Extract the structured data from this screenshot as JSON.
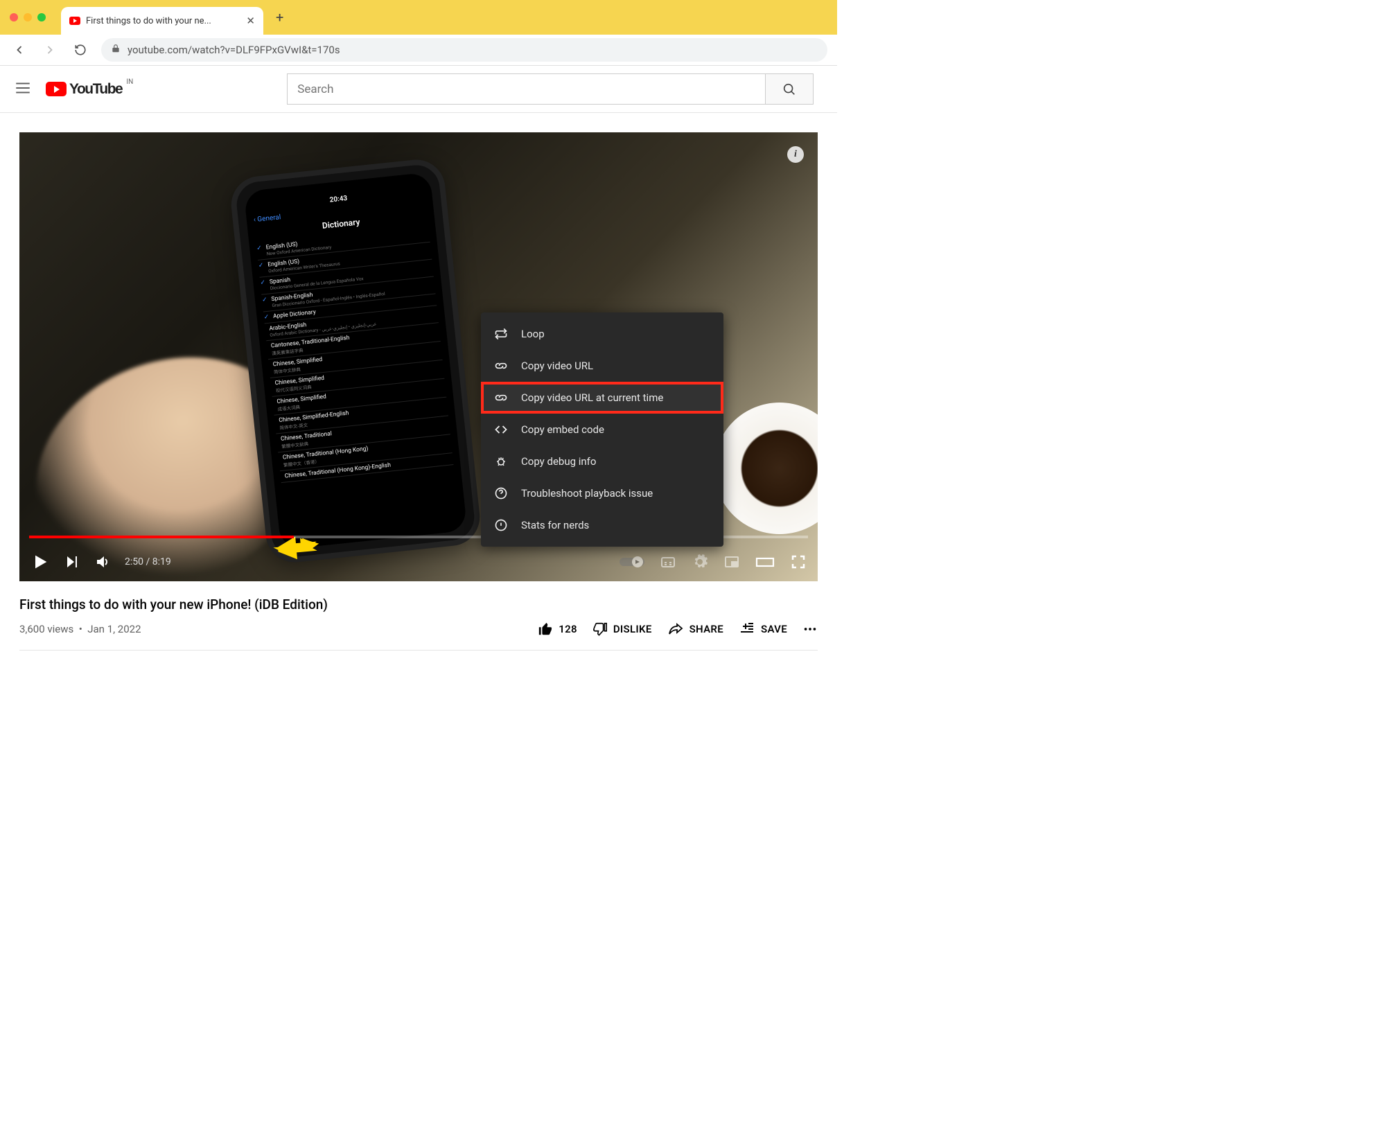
{
  "browser": {
    "tab_title": "First things to do with your ne...",
    "url": "youtube.com/watch?v=DLF9FPxGVwI&t=170s"
  },
  "yt_header": {
    "logo_text": "YouTube",
    "region": "IN",
    "search_placeholder": "Search"
  },
  "player": {
    "time_current": "2:50",
    "time_total": "8:19",
    "progress_percent": 34,
    "phone": {
      "clock": "20:43",
      "back": "General",
      "title": "Dictionary",
      "rows": [
        {
          "checked": true,
          "main": "English (US)",
          "sub": "New Oxford American Dictionary"
        },
        {
          "checked": true,
          "main": "English (US)",
          "sub": "Oxford American Writer's Thesaurus"
        },
        {
          "checked": true,
          "main": "Spanish",
          "sub": "Diccionario General de la Lengua Española Vox"
        },
        {
          "checked": true,
          "main": "Spanish-English",
          "sub": "Gran Diccionario Oxford - Español-Inglés • Inglés-Español"
        },
        {
          "checked": true,
          "main": "Apple Dictionary",
          "sub": ""
        },
        {
          "checked": false,
          "main": "Arabic-English",
          "sub": "Oxford Arabic Dictionary - عربي-إنجليزي • إنجليزي-عربي"
        },
        {
          "checked": false,
          "main": "Cantonese, Traditional-English",
          "sub": "漢英廣東話字典"
        },
        {
          "checked": false,
          "main": "Chinese, Simplified",
          "sub": "简体中文辞典"
        },
        {
          "checked": false,
          "main": "Chinese, Simplified",
          "sub": "现代汉语同义词典"
        },
        {
          "checked": false,
          "main": "Chinese, Simplified",
          "sub": "成语大词典"
        },
        {
          "checked": false,
          "main": "Chinese, Simplified-English",
          "sub": "简体中文-英文"
        },
        {
          "checked": false,
          "main": "Chinese, Traditional",
          "sub": "繁體中文辭典"
        },
        {
          "checked": false,
          "main": "Chinese, Traditional (Hong Kong)",
          "sub": "繁體中文（香港）"
        },
        {
          "checked": false,
          "main": "Chinese, Traditional (Hong Kong)-English",
          "sub": ""
        }
      ]
    }
  },
  "context_menu": {
    "items": [
      {
        "key": "loop",
        "label": "Loop"
      },
      {
        "key": "copy-url",
        "label": "Copy video URL"
      },
      {
        "key": "copy-url-time",
        "label": "Copy video URL at current time",
        "highlight": true
      },
      {
        "key": "copy-embed",
        "label": "Copy embed code"
      },
      {
        "key": "copy-debug",
        "label": "Copy debug info"
      },
      {
        "key": "troubleshoot",
        "label": "Troubleshoot playback issue"
      },
      {
        "key": "stats",
        "label": "Stats for nerds"
      }
    ]
  },
  "video": {
    "title": "First things to do with your new iPhone! (iDB Edition)",
    "views": "3,600 views",
    "sep": "•",
    "date": "Jan 1, 2022",
    "like_count": "128",
    "dislike_label": "DISLIKE",
    "share_label": "SHARE",
    "save_label": "SAVE"
  }
}
